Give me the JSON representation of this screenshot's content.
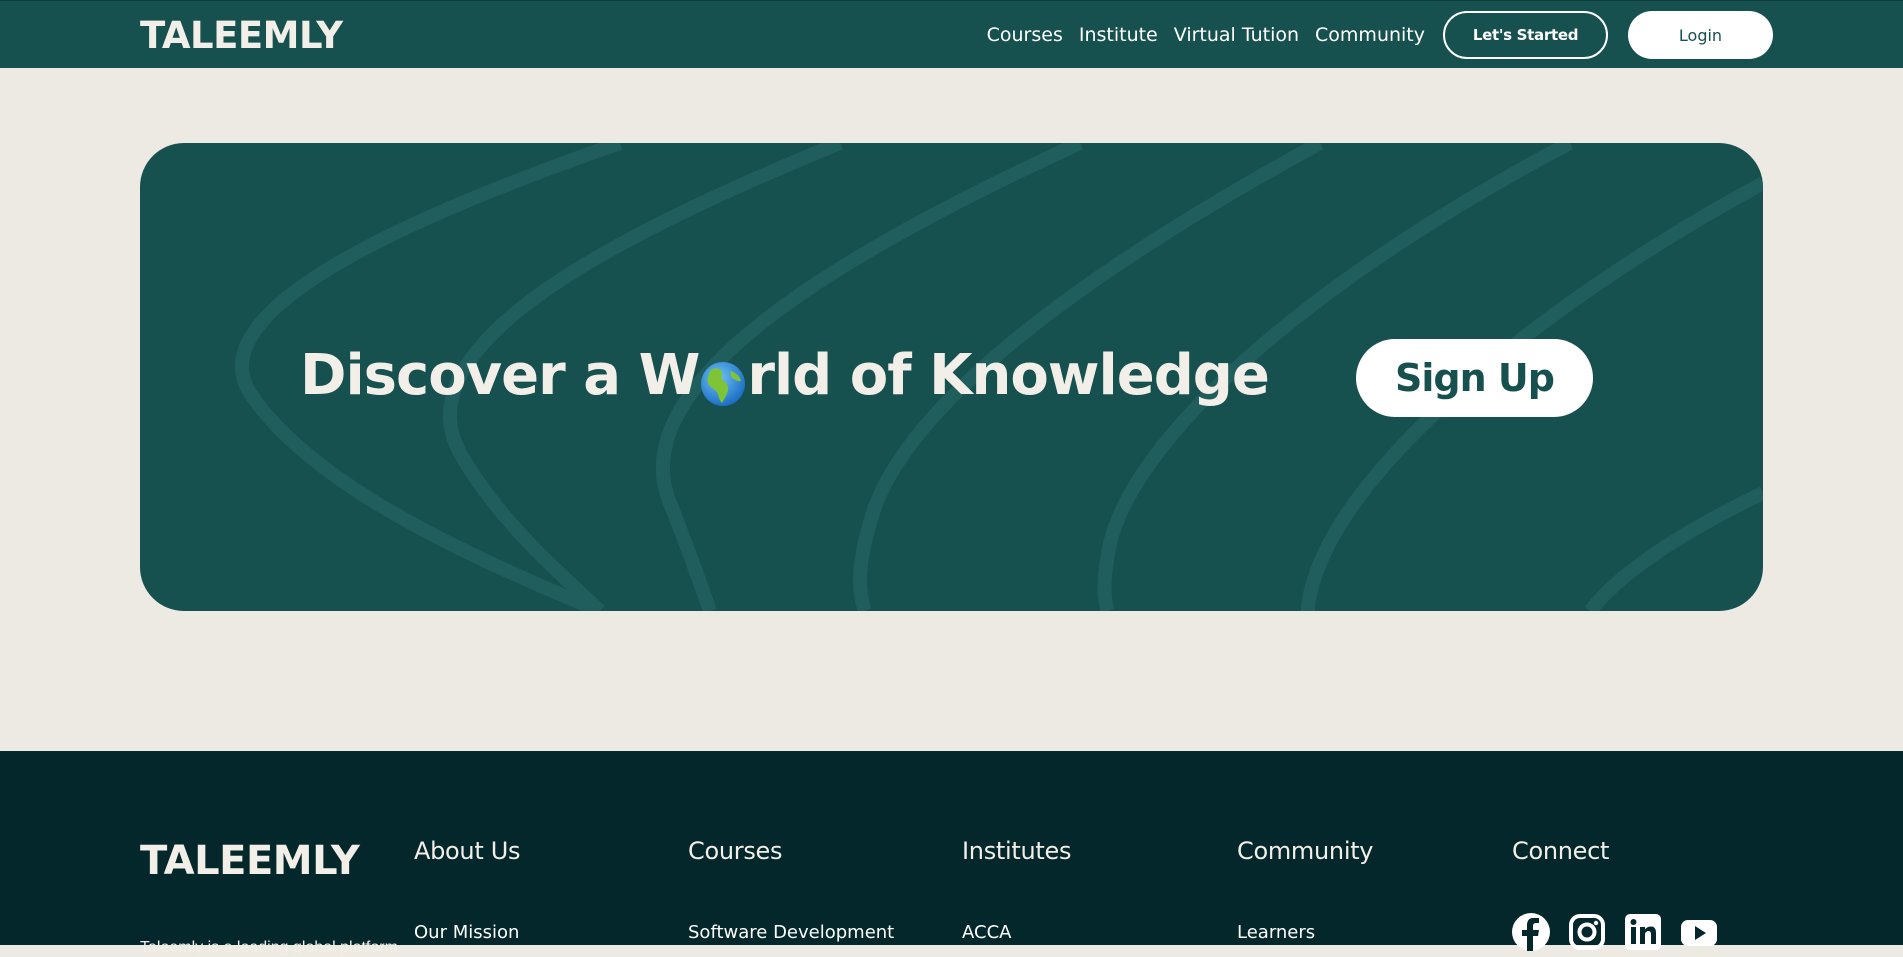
{
  "header": {
    "logo": "TALEEMLY",
    "nav": [
      "Courses",
      "Institute",
      "Virtual Tution",
      "Community"
    ],
    "cta_label": "Let's Started",
    "login_label": "Login"
  },
  "hero": {
    "title_before": "Discover a W",
    "title_icon": "globe-icon",
    "title_after": "rld of Knowledge",
    "signup_label": "Sign Up"
  },
  "footer": {
    "logo": "TALEEMLY",
    "tagline": "Taleemly is a leading global platform",
    "columns": [
      {
        "title": "About Us",
        "first_item": "Our Mission"
      },
      {
        "title": "Courses",
        "first_item": "Software Development"
      },
      {
        "title": "Institutes",
        "first_item": "ACCA"
      },
      {
        "title": "Community",
        "first_item": "Learners"
      }
    ],
    "connect_title": "Connect",
    "social_icons": [
      "facebook-icon",
      "instagram-icon",
      "linkedin-icon",
      "youtube-icon"
    ]
  },
  "colors": {
    "brand": "#16504f",
    "background": "#ede9e3",
    "footer": "#03272a"
  }
}
